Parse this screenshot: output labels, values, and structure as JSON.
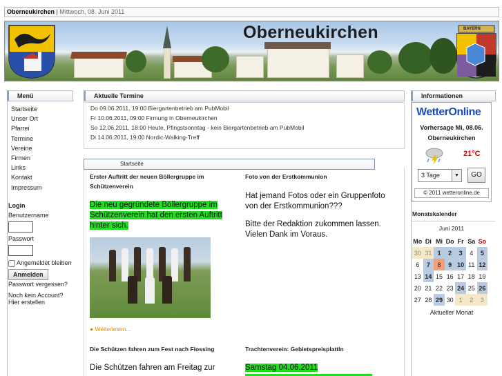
{
  "topbar": {
    "site": "Oberneukirchen",
    "sep": "|",
    "date": "Mittwoch, 08. Juni 2011"
  },
  "banner": {
    "title": "Oberneukirchen",
    "crest_label": "BAYERN"
  },
  "menu": {
    "header": "Menü",
    "items": [
      "Startseite",
      "Unser Ort",
      "Pfarrei",
      "Termine",
      "Vereine",
      "Firmen",
      "Links",
      "Kontakt",
      "Impressum"
    ]
  },
  "login": {
    "title": "Login",
    "user_label": "Benutzername",
    "pass_label": "Passwort",
    "remember_label": "Angemeldet bleiben",
    "button": "Anmelden",
    "forgot": "Passwort vergessen?",
    "no_account": "Noch kein Account?",
    "register": "Hier erstellen"
  },
  "termine": {
    "header": "Aktuelle Termine",
    "items": [
      "Do 09.06.2011, 19:00 Biergartenbetrieb am PubMobil",
      "Fr 10.06.2011, 09:00 Firmung in Oberneukirchen",
      "So 12.06.2011, 18:00 Heute, Pfingstsonntag - kein Biergartenbetrieb am PubMobil",
      "Di 14.06.2011, 19:00 Nordic-Walking-Treff"
    ]
  },
  "startseite": {
    "header": "Startseite",
    "articles": [
      {
        "title": "Erster Auftritt der neuen Böllergruppe im Schützenverein",
        "text": "Die neu gegründete Böllergruppe im Schützenverein hat den ersten Auftritt hinter sich.",
        "more": "Weiterlesen..."
      },
      {
        "title": "Foto von der Erstkommunion",
        "text1": "Hat jemand Fotos oder ein Gruppenfoto von der Erstkommunion???",
        "text2": "Bitte der Redaktion zukommen lassen. Vielen Dank im Voraus."
      },
      {
        "title": "Die Schützen fahren zum Fest nach Flossing",
        "text": "Die Schützen fahren am Freitag zur"
      },
      {
        "title": "Trachtenverein: Gebietspreisplattln",
        "text": "Samstag 04.06.2011"
      }
    ]
  },
  "informationen": {
    "header": "Informationen",
    "weather_brand": "WetterOnline",
    "forecast_line1": "Vorhersage Mi, 08.06.",
    "forecast_line2": "Oberneukirchen",
    "temperature": "21°C",
    "select_value": "3 Tage",
    "go_button": "GO",
    "copyright": "© 2011 wetteronline.de"
  },
  "calendar": {
    "header": "Monatskalender",
    "month": "Juni 2011",
    "weekdays": [
      "Mo",
      "Di",
      "Mi",
      "Do",
      "Fr",
      "Sa",
      "So"
    ],
    "weeks": [
      [
        "30",
        "31",
        "1",
        "2",
        "3",
        "4",
        "5"
      ],
      [
        "6",
        "7",
        "8",
        "9",
        "10",
        "11",
        "12"
      ],
      [
        "13",
        "14",
        "15",
        "16",
        "17",
        "18",
        "19"
      ],
      [
        "20",
        "21",
        "22",
        "23",
        "24",
        "25",
        "26"
      ],
      [
        "27",
        "28",
        "29",
        "30",
        "1",
        "2",
        "3"
      ]
    ],
    "footer": "Aktueller Monat",
    "colors": {
      "event": "#b9cbe0",
      "today": "#f2a07a",
      "outside": "#f5e8c8",
      "sunday": "#cc0000"
    }
  }
}
